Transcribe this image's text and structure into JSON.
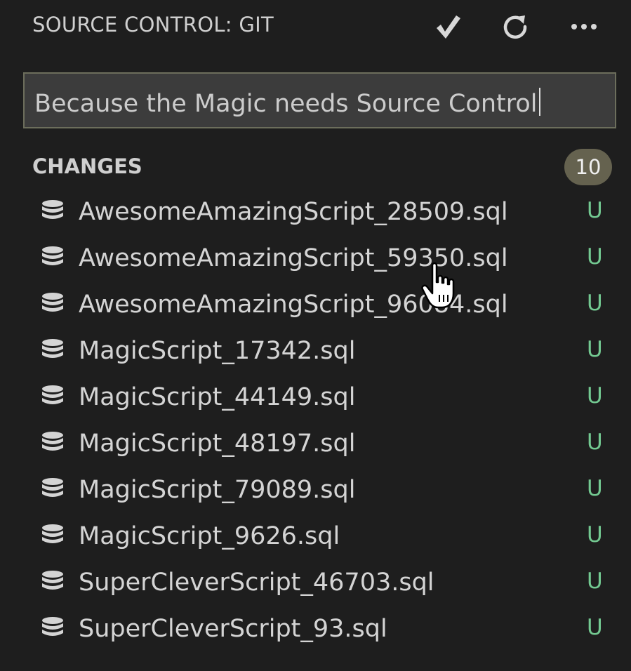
{
  "header": {
    "title": "SOURCE CONTROL: GIT",
    "actions": [
      {
        "name": "commit",
        "icon": "checkmark-icon"
      },
      {
        "name": "refresh",
        "icon": "refresh-icon"
      },
      {
        "name": "more",
        "icon": "more-icon"
      }
    ]
  },
  "commit_message": {
    "value": "Because the Magic needs Source Control",
    "placeholder": ""
  },
  "changes": {
    "title": "CHANGES",
    "count": "10",
    "files": [
      {
        "name": "AwesomeAmazingScript_28509.sql",
        "status": "U"
      },
      {
        "name": "AwesomeAmazingScript_59350.sql",
        "status": "U"
      },
      {
        "name": "AwesomeAmazingScript_96084.sql",
        "status": "U"
      },
      {
        "name": "MagicScript_17342.sql",
        "status": "U"
      },
      {
        "name": "MagicScript_44149.sql",
        "status": "U"
      },
      {
        "name": "MagicScript_48197.sql",
        "status": "U"
      },
      {
        "name": "MagicScript_79089.sql",
        "status": "U"
      },
      {
        "name": "MagicScript_9626.sql",
        "status": "U"
      },
      {
        "name": "SuperCleverScript_46703.sql",
        "status": "U"
      },
      {
        "name": "SuperCleverScript_93.sql",
        "status": "U"
      }
    ]
  },
  "colors": {
    "background": "#1e1e1e",
    "input_background": "#3c3c3c",
    "input_border": "#6c6e5c",
    "badge_background": "#65624f",
    "untracked_status": "#73c991",
    "text": "#cccccc"
  }
}
